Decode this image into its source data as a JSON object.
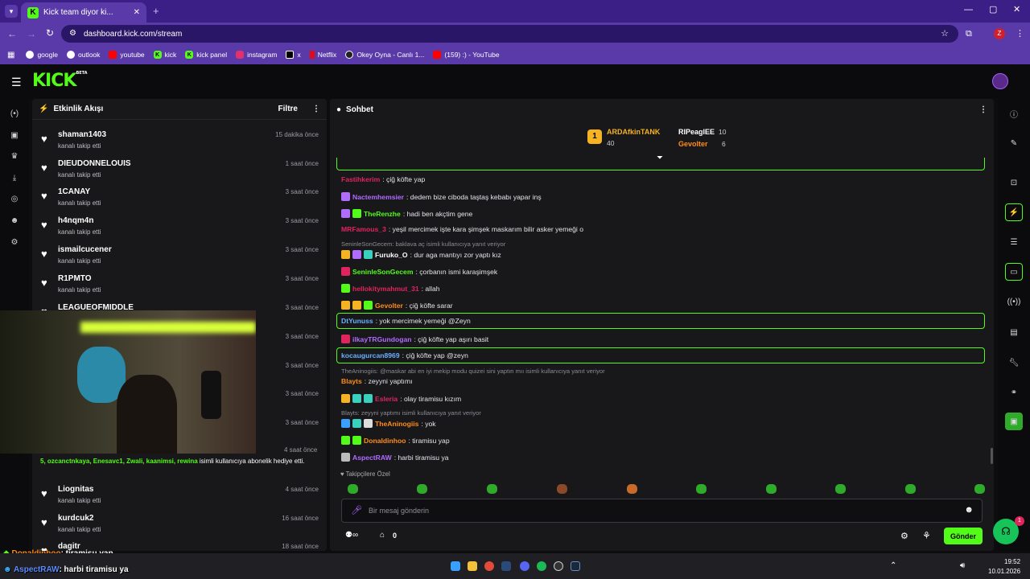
{
  "browser": {
    "tab_title": "Kick team diyor ki...",
    "url": "dashboard.kick.com/stream",
    "profile_initial": "Z",
    "bookmarks": [
      "google",
      "outlook",
      "youtube",
      "kick",
      "kick panel",
      "instagram",
      "x",
      "Netflix",
      "Okey Oyna - Canlı 1...",
      "(159) :) - YouTube"
    ]
  },
  "kick": {
    "logo": "KICK",
    "beta": "BETA"
  },
  "activity": {
    "title": "Etkinlik Akışı",
    "filter": "Filtre",
    "items": [
      {
        "name": "shaman1403",
        "sub": "kanalı takip etti",
        "time": "15 dakika önce"
      },
      {
        "name": "DIEUDONNELOUIS",
        "sub": "kanalı takip etti",
        "time": "1 saat önce"
      },
      {
        "name": "1CANAY",
        "sub": "kanalı takip etti",
        "time": "3 saat önce"
      },
      {
        "name": "h4nqm4n",
        "sub": "kanalı takip etti",
        "time": "3 saat önce"
      },
      {
        "name": "ismailcucener",
        "sub": "kanalı takip etti",
        "time": "3 saat önce"
      },
      {
        "name": "R1PMTO",
        "sub": "kanalı takip etti",
        "time": "3 saat önce"
      },
      {
        "name": "LEAGUEOFMIDDLE",
        "sub": "",
        "time": "3 saat önce"
      }
    ],
    "hidden_times": [
      "3 saat önce",
      "3 saat önce",
      "3 saat önce",
      "3 saat önce"
    ],
    "sub_event": {
      "time": "4 saat önce",
      "users": "5, ozcanctnkaya, Enesavc1, Zwali, kaanimsi, rewina",
      "text": "isimli kullanıcıya abonelik hediye etti."
    },
    "items2": [
      {
        "name": "Liognitas",
        "sub": "kanalı takip etti",
        "time": "4 saat önce"
      },
      {
        "name": "kurdcuk2",
        "sub": "kanalı takip etti",
        "time": "16 saat önce"
      },
      {
        "name": "dagitr",
        "sub": "",
        "time": "18 saat önce"
      }
    ]
  },
  "chat": {
    "title": "Sohbet",
    "leaders": {
      "first": {
        "name": "ARDAfkinTANK",
        "count": "40"
      },
      "second": {
        "name": "RIPeaglEE",
        "count": "10"
      },
      "third": {
        "name": "Gevolter",
        "count": "6"
      }
    },
    "messages": [
      {
        "user": "Fastihkerim",
        "text": ": çiğ köfte yap",
        "color": "#e0245e"
      },
      {
        "user": "Nactemhemsier",
        "text": ": dedem bize ciboda taştaş kebabı yapar inş",
        "color": "#b06bff"
      },
      {
        "user": "TheRenzhe",
        "text": ": hadi ben akçtim gene",
        "color": "#53fc18"
      },
      {
        "user": "MRFamous_3",
        "text": ": yeşil mercimek işte kara şimşek maskarım bilir asker yemeği o",
        "color": "#e0245e"
      },
      {
        "reply": "SeninleSonGecem: baklava aç isimli kullanıcıya yanıt veriyor"
      },
      {
        "user": "Furuko_O",
        "text": ": dur aga mantıyı zor yaptı kız",
        "color": "#ffffff"
      },
      {
        "user": "SeninleSonGecem",
        "text": ": çorbanın ismi karaşimşek",
        "color": "#53fc18"
      },
      {
        "user": "hellokitymahmut_31",
        "text": ": allah",
        "color": "#e0245e"
      },
      {
        "user": "Gevolter",
        "text": ": çiğ köfte sarar",
        "color": "#ff8c1a"
      },
      {
        "user": "DtYunuss",
        "text": ": yok mercimek yemeği @Zeyn",
        "color": "#66b2ff"
      },
      {
        "user": "ilkayTRGundogan",
        "text": ": çiğ köfte yap aşırı basit",
        "color": "#b06bff"
      },
      {
        "user": "kocaugurcan8969",
        "text": ": çiğ köfte yap @zeyn",
        "color": "#66b2ff"
      },
      {
        "reply": "TheAninogiis: @maskar abi en iyi mekip modu quizei sini yaptın mıı isimli kullanıcıya yanıt veriyor"
      },
      {
        "user": "Blayts",
        "text": ": zeyyni yaptımı",
        "color": "#ff8c1a"
      },
      {
        "user": "Esleria",
        "text": ": olay tiramisu kızım",
        "color": "#e0245e"
      },
      {
        "reply": "Blayts: zeyyni yaptımı isimli kullanıcıya yanıt veriyor"
      },
      {
        "user": "TheAninogiis",
        "text": ": yok",
        "color": "#ff8c1a"
      },
      {
        "user": "Donaldinhoo",
        "text": ": tiramisu yap",
        "color": "#ff8c1a"
      },
      {
        "user": "AspectRAW",
        "text": ": harbi tiramisu ya",
        "color": "#b06bff"
      }
    ],
    "emote_tab": "Takipçilere Özel",
    "input_placeholder": "Bir mesaj gönderin",
    "points": "0",
    "send": "Gönder"
  },
  "overlay": {
    "line1_user": "Donaldinhoo",
    "line1_text": ": tiramisu yap",
    "line2_user": "AspectRAW",
    "line2_text": ": harbi tiramisu ya"
  },
  "taskbar": {
    "time": "19:52",
    "date": "10.01.2026"
  }
}
